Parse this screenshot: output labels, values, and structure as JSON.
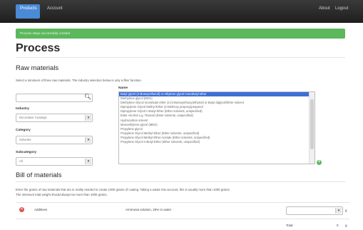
{
  "navbar": {
    "tabs": [
      {
        "label": "Products",
        "active": true
      },
      {
        "label": "Account",
        "active": false
      }
    ],
    "right_links": [
      "About",
      "Logout"
    ]
  },
  "alert": {
    "text": "Process steps successfully created",
    "color": "#5cb85c"
  },
  "page": {
    "title": "Process"
  },
  "raw_materials": {
    "heading": "Raw materials",
    "help": "Select a minimum of three raw materials. The industry selection below is only a filter function.",
    "search": {
      "placeholder": "",
      "icon": "search-icon"
    },
    "filters": [
      {
        "label": "Industry",
        "value": "Decorative Coatings"
      },
      {
        "label": "Category",
        "value": "Solvents"
      },
      {
        "label": "Subcategory",
        "value": "All"
      }
    ],
    "list_label": "Name",
    "options": [
      {
        "label": "Butyl glycol (2-Butoxyethanol) or ethylene glycol monobutyl ether",
        "selected": true
      },
      {
        "label": "Diethylene glycol (DEG)",
        "selected": false
      },
      {
        "label": "Diethylene Glycol monobutyl ether (2-(2-Butoxyethoxy)ethanol) or Butyl diglycol/Ether solvent",
        "selected": false
      },
      {
        "label": "Dipropylene Glycol Methyl Ether (2-Methoxy propoxy)propanol",
        "selected": false
      },
      {
        "label": "Dipropylene Glycol n-Butyl Ether (Ether solvents, unspecified)",
        "selected": false
      },
      {
        "label": "Ester Alcohol e.g. Texanol (Ester solvents, unspecified)",
        "selected": false
      },
      {
        "label": "Hydrocarbon solvent",
        "selected": false
      },
      {
        "label": "Monoethylene glycol (MEG)",
        "selected": false
      },
      {
        "label": "Propylene glycol",
        "selected": false
      },
      {
        "label": "Propylene Glycol Methyl Ether (Ether solvents, unspecified)",
        "selected": false
      },
      {
        "label": "Propylene Glycol Methyl Ether Acetate (Ether solvents, unspecified)",
        "selected": false
      },
      {
        "label": "Propylene Glycol n-Butyl Ether (Ether solvents, unspecified)",
        "selected": false
      }
    ]
  },
  "bill_of_materials": {
    "heading": "Bill of materials",
    "help_line1": "Enter the grams of raw materials that are in reality needed to create 1000 grams of coating. Taking a waste into account, this is usually more than 1000 grams.",
    "help_line2": "The minimum total weight should always be more than 1000 grams.",
    "rows": [
      {
        "name": "Additives",
        "description": "Ammonia solution, 25% in water",
        "unit": "g"
      }
    ],
    "total": {
      "label": "Total",
      "value": "0",
      "unit": "g"
    }
  }
}
